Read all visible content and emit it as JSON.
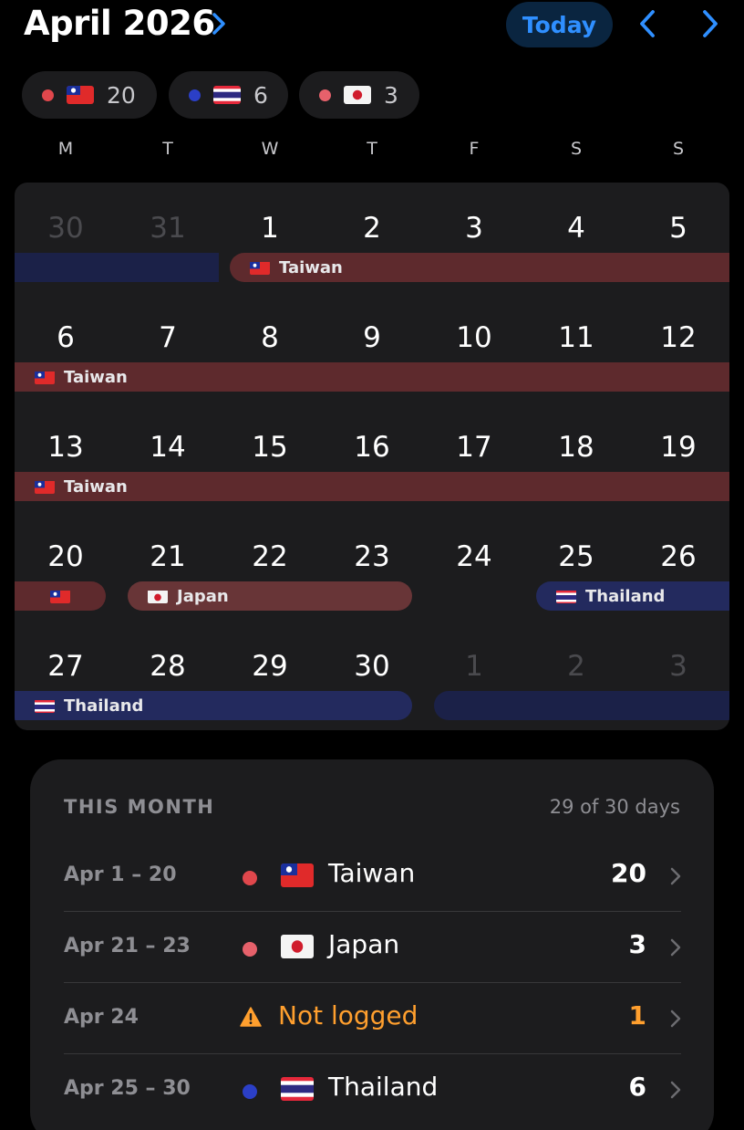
{
  "header": {
    "month_title": "April 2026",
    "today_label": "Today",
    "colors": {
      "accent": "#2f8fff"
    }
  },
  "chips": [
    {
      "dot_color": "#e0474c",
      "flag": "taiwan",
      "count": "20"
    },
    {
      "dot_color": "#2b3fc7",
      "flag": "thailand",
      "count": "6"
    },
    {
      "dot_color": "#e6616b",
      "flag": "japan",
      "count": "3"
    }
  ],
  "weekdays": [
    "M",
    "T",
    "W",
    "T",
    "F",
    "S",
    "S"
  ],
  "calendar": {
    "weeks": [
      [
        {
          "label": "30",
          "dim": true
        },
        {
          "label": "31",
          "dim": true
        },
        {
          "label": "1"
        },
        {
          "label": "2"
        },
        {
          "label": "3"
        },
        {
          "label": "4"
        },
        {
          "label": "5"
        }
      ],
      [
        {
          "label": "6"
        },
        {
          "label": "7"
        },
        {
          "label": "8"
        },
        {
          "label": "9"
        },
        {
          "label": "10"
        },
        {
          "label": "11"
        },
        {
          "label": "12"
        }
      ],
      [
        {
          "label": "13"
        },
        {
          "label": "14"
        },
        {
          "label": "15"
        },
        {
          "label": "16"
        },
        {
          "label": "17"
        },
        {
          "label": "18"
        },
        {
          "label": "19"
        }
      ],
      [
        {
          "label": "20"
        },
        {
          "label": "21"
        },
        {
          "label": "22"
        },
        {
          "label": "23"
        },
        {
          "label": "24"
        },
        {
          "label": "25"
        },
        {
          "label": "26"
        }
      ],
      [
        {
          "label": "27"
        },
        {
          "label": "28"
        },
        {
          "label": "29"
        },
        {
          "label": "30"
        },
        {
          "label": "1",
          "dim": true
        },
        {
          "label": "2",
          "dim": true
        },
        {
          "label": "3",
          "dim": true
        }
      ]
    ],
    "events": [
      {
        "week": 0,
        "start": 0,
        "end": 1,
        "kind": "thdim",
        "label": "",
        "flag": ""
      },
      {
        "week": 0,
        "start": 2,
        "end": 6,
        "kind": "tw",
        "label": "Taiwan",
        "flag": "taiwan"
      },
      {
        "week": 1,
        "start": 0,
        "end": 6,
        "kind": "tw",
        "label": "Taiwan",
        "flag": "taiwan"
      },
      {
        "week": 2,
        "start": 0,
        "end": 6,
        "kind": "tw",
        "label": "Taiwan",
        "flag": "taiwan"
      },
      {
        "week": 3,
        "start": 0,
        "end": 0,
        "kind": "tw",
        "label": "",
        "flag": "taiwan"
      },
      {
        "week": 3,
        "start": 1,
        "end": 3,
        "kind": "jp",
        "label": "Japan",
        "flag": "japan"
      },
      {
        "week": 3,
        "start": 5,
        "end": 6,
        "kind": "th",
        "label": "Thailand",
        "flag": "thailand"
      },
      {
        "week": 4,
        "start": 0,
        "end": 3,
        "kind": "th",
        "label": "Thailand",
        "flag": "thailand"
      },
      {
        "week": 4,
        "start": 4,
        "end": 6,
        "kind": "thdim",
        "label": "",
        "flag": ""
      }
    ]
  },
  "summary": {
    "title": "THIS MONTH",
    "days_text": "29 of 30 days",
    "rows": [
      {
        "range": "Apr 1 – 20",
        "dot_color": "#e0474c",
        "flag": "taiwan",
        "name": "Taiwan",
        "count": "20"
      },
      {
        "range": "Apr 21 – 23",
        "dot_color": "#e6616b",
        "flag": "japan",
        "name": "Japan",
        "count": "3"
      },
      {
        "range": "Apr 24",
        "warning": true,
        "name": "Not logged",
        "count": "1"
      },
      {
        "range": "Apr 25 – 30",
        "dot_color": "#2b3fc7",
        "flag": "thailand",
        "name": "Thailand",
        "count": "6"
      }
    ]
  }
}
